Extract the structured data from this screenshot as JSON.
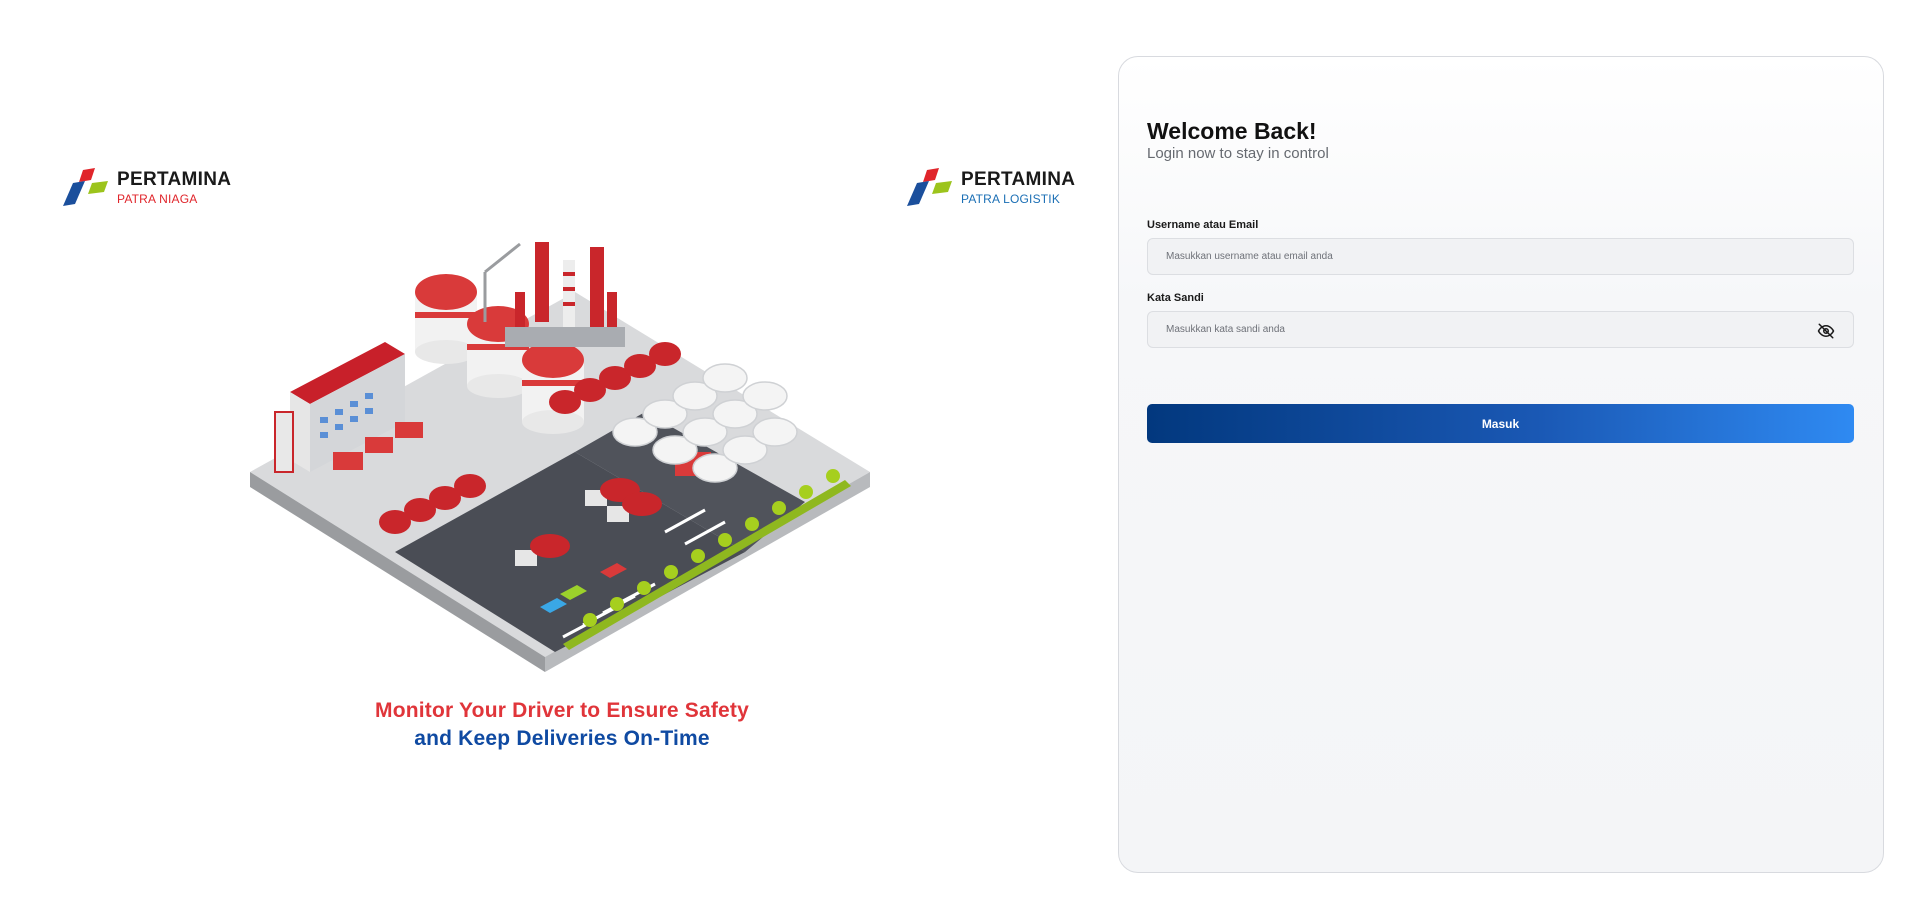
{
  "logos": {
    "left": {
      "brand": "PERTAMINA",
      "sub": "PATRA NIAGA"
    },
    "right": {
      "brand": "PERTAMINA",
      "sub": "PATRA LOGISTIK"
    }
  },
  "hero": {
    "tagline_line1": "Monitor Your Driver to Ensure Safety",
    "tagline_line2": "and Keep Deliveries On-Time",
    "illustration_icon": "refinery-depot-illustration"
  },
  "login": {
    "title": "Welcome Back!",
    "subtitle": "Login now to stay in control",
    "username_label": "Username atau Email",
    "username_placeholder": "Masukkan username atau email anda",
    "username_value": "",
    "password_label": "Kata Sandi",
    "password_placeholder": "Masukkan kata sandi anda",
    "password_value": "",
    "password_toggle_icon": "eye-off-icon",
    "submit_label": "Masuk"
  },
  "colors": {
    "brand_red": "#e0252b",
    "brand_blue": "#0f4aa2",
    "brand_green": "#9cc41c",
    "button_gradient_start": "#02387e",
    "button_gradient_end": "#2f8af2"
  }
}
